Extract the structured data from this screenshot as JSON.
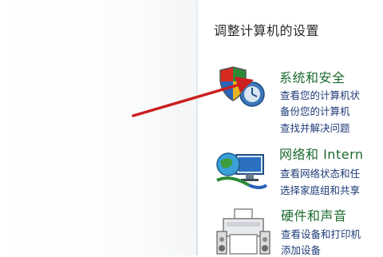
{
  "page": {
    "title": "调整计算机的设置"
  },
  "categories": [
    {
      "title": "系统和安全",
      "icon": "shield-icon",
      "links": [
        "查看您的计算机状",
        "备份您的计算机",
        "查找并解决问题"
      ]
    },
    {
      "title": "网络和 Intern",
      "icon": "network-globe-icon",
      "links": [
        "查看网络状态和任",
        "选择家庭组和共享"
      ]
    },
    {
      "title": "硬件和声音",
      "icon": "printer-icon",
      "links": [
        "查看设备和打印机",
        "添加设备"
      ]
    }
  ],
  "colors": {
    "category_title": "#1c6a2e",
    "link": "#1f3c78",
    "annotation_arrow": "#cc1f1f"
  }
}
